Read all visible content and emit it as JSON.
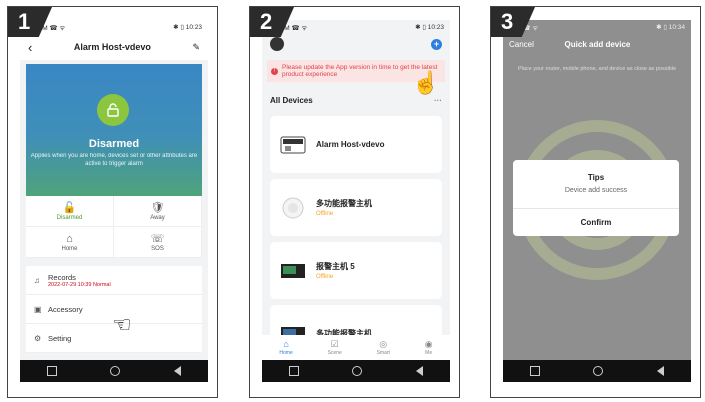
{
  "panel1": {
    "step": "1",
    "status_left": "No SIM ☎ ᯤ",
    "status_right": "✱ ▯ 10:23",
    "title": "Alarm Host-vdevo",
    "back_icon": "‹",
    "edit_icon": "✎",
    "hero_status": "Disarmed",
    "hero_desc": "Applies when you are home, devices set or other attributes are active to trigger alarm",
    "modes": [
      {
        "label": "Disarmed",
        "icon": "🔓"
      },
      {
        "label": "Away",
        "icon": "🛡"
      },
      {
        "label": "Home",
        "icon": "⌂"
      },
      {
        "label": "SOS",
        "icon": "☏"
      }
    ],
    "records_label": "Records",
    "records_sub": "2022-07-29 10:39 Normal",
    "accessory_label": "Accessory",
    "setting_label": "Setting"
  },
  "panel2": {
    "step": "2",
    "status_left": "No SIM ☎ ᯤ",
    "status_right": "✱ ▯ 10:23",
    "warning": "Please update the App version in time to get the latest product experience",
    "section_title": "All Devices",
    "more": "···",
    "devices": [
      {
        "name": "Alarm Host-vdevo",
        "status": ""
      },
      {
        "name": "多功能报警主机",
        "status": "Offline"
      },
      {
        "name": "报警主机 5",
        "status": "Offline"
      },
      {
        "name": "多功能报警主机",
        "status": ""
      }
    ],
    "tabs": [
      "Home",
      "Scene",
      "Smart",
      "Me"
    ]
  },
  "panel3": {
    "step": "3",
    "status_left": "SIM ☎ ᯤ",
    "status_right": "✱ ▯ 10:34",
    "cancel": "Cancel",
    "title": "Quick add device",
    "desc": "Place your router, mobile phone, and device as close as possible",
    "dialog_title": "Tips",
    "dialog_msg": "Device add success",
    "confirm": "Confirm"
  }
}
